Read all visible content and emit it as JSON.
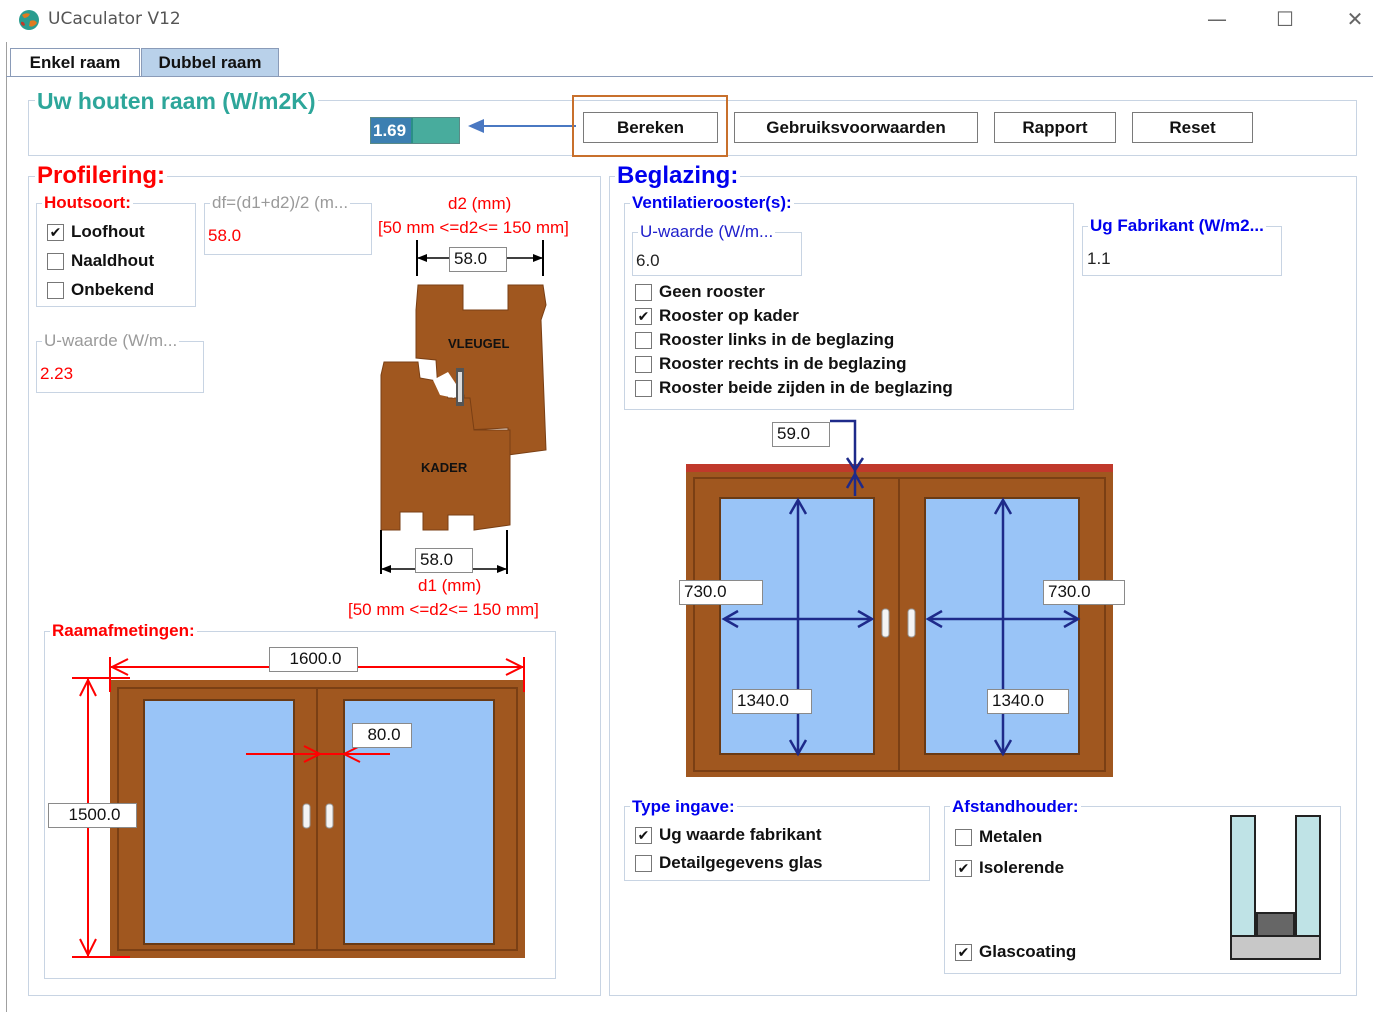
{
  "window": {
    "title": "UCaculator V12",
    "minimize": "—",
    "maximize": "☐",
    "close": "✕"
  },
  "tabs": [
    {
      "label": "Enkel raam"
    },
    {
      "label": "Dubbel raam",
      "active": true
    }
  ],
  "result": {
    "label": "Uw houten raam (W/m2K)",
    "value": "1.69"
  },
  "toolbar": {
    "bereken": "Bereken",
    "gebruik": "Gebruiksvoorwaarden",
    "rapport": "Rapport",
    "reset": "Reset"
  },
  "profilering": {
    "title": "Profilering:",
    "houtsoort": {
      "label": "Houtsoort:",
      "options": [
        {
          "label": "Loofhout",
          "checked": true
        },
        {
          "label": "Naaldhout",
          "checked": false
        },
        {
          "label": "Onbekend",
          "checked": false
        }
      ]
    },
    "df": {
      "label": "df=(d1+d2)/2 (m...",
      "value": "58.0"
    },
    "uwaarde": {
      "label": "U-waarde (W/m...",
      "value": "2.23"
    },
    "d2": {
      "label": "d2 (mm)",
      "range": "[50 mm <=d2<= 150 mm]",
      "value": "58.0"
    },
    "d1": {
      "label": "d1 (mm)",
      "range": "[50 mm <=d2<= 150 mm]",
      "value": "58.0"
    },
    "profile_labels": {
      "vleugel": "VLEUGEL",
      "kader": "KADER"
    }
  },
  "raamafmetingen": {
    "label": "Raamafmetingen:",
    "width": "1600.0",
    "height": "1500.0",
    "middle": "80.0"
  },
  "beglazing": {
    "title": "Beglazing:",
    "ventilatie": {
      "label": "Ventilatierooster(s):",
      "uwaarde_label": "U-waarde (W/m...",
      "uwaarde_value": "6.0",
      "options": [
        {
          "label": "Geen rooster",
          "checked": false
        },
        {
          "label": "Rooster op kader",
          "checked": true
        },
        {
          "label": "Rooster links in de beglazing",
          "checked": false
        },
        {
          "label": "Rooster rechts in de beglazing",
          "checked": false
        },
        {
          "label": "Rooster beide zijden in de beglazing",
          "checked": false
        }
      ]
    },
    "ug": {
      "label": "Ug Fabrikant (W/m2...",
      "value": "1.1"
    },
    "dims": {
      "top": "59.0",
      "left_width": "730.0",
      "right_width": "730.0",
      "left_height": "1340.0",
      "right_height": "1340.0"
    },
    "type_ingave": {
      "label": "Type ingave:",
      "options": [
        {
          "label": "Ug waarde fabrikant",
          "checked": true
        },
        {
          "label": "Detailgegevens glas",
          "checked": false
        }
      ]
    },
    "afstandhouder": {
      "label": "Afstandhouder:",
      "options": [
        {
          "label": "Metalen",
          "checked": false
        },
        {
          "label": "Isolerende",
          "checked": true
        }
      ],
      "glascoating": {
        "label": "Glascoating",
        "checked": true
      }
    }
  },
  "colors": {
    "wood": "#a0571f",
    "glass": "#99c4f7",
    "red": "#ff0000",
    "navy": "#1e2a8a",
    "result_bg": "#2a8f86"
  }
}
